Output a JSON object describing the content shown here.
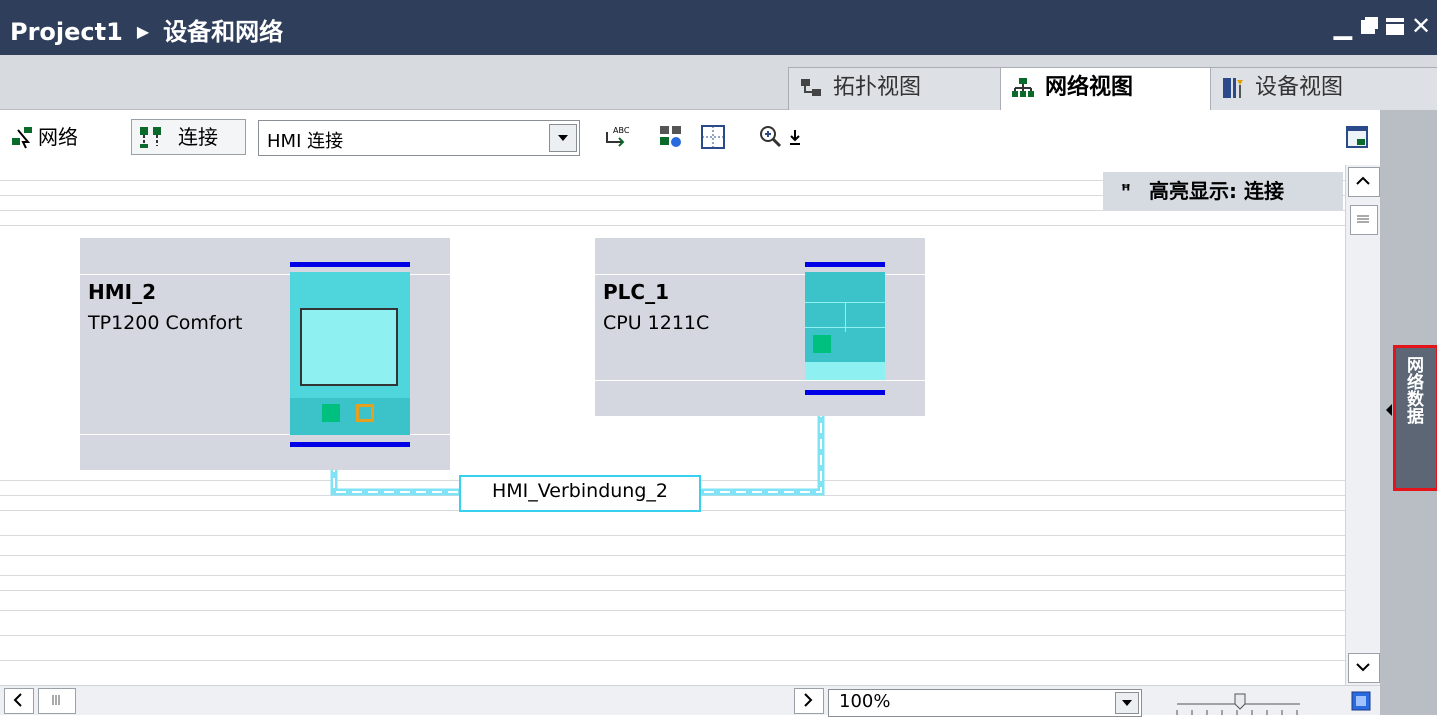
{
  "window": {
    "project": "Project1",
    "title": "设备和网络"
  },
  "tabs": [
    {
      "label": "拓扑视图",
      "icon": "topology-icon"
    },
    {
      "label": "网络视图",
      "icon": "network-icon"
    },
    {
      "label": "设备视图",
      "icon": "device-icon"
    }
  ],
  "active_tab": "网络视图",
  "toolbar": {
    "network_label": "网络",
    "connect_label": "连接",
    "connection_type_value": "HMI 连接",
    "highlight_label": "高亮显示: 连接"
  },
  "devices": [
    {
      "name": "HMI_2",
      "type": "TP1200 Comfort"
    },
    {
      "name": "PLC_1",
      "type": "CPU 1211C"
    }
  ],
  "connection": {
    "label": "HMI_Verbindung_2",
    "color": "#36d1ee"
  },
  "zoom": {
    "value": "100%"
  },
  "side_panel": {
    "label": "网络数据"
  },
  "colors": {
    "title_bg": "#2f3e5a",
    "device_bg": "#d4d6e0",
    "device_teal": "#4fd6dc",
    "bus_blue": "#0000e6",
    "side_tab_border": "#e5141a"
  }
}
